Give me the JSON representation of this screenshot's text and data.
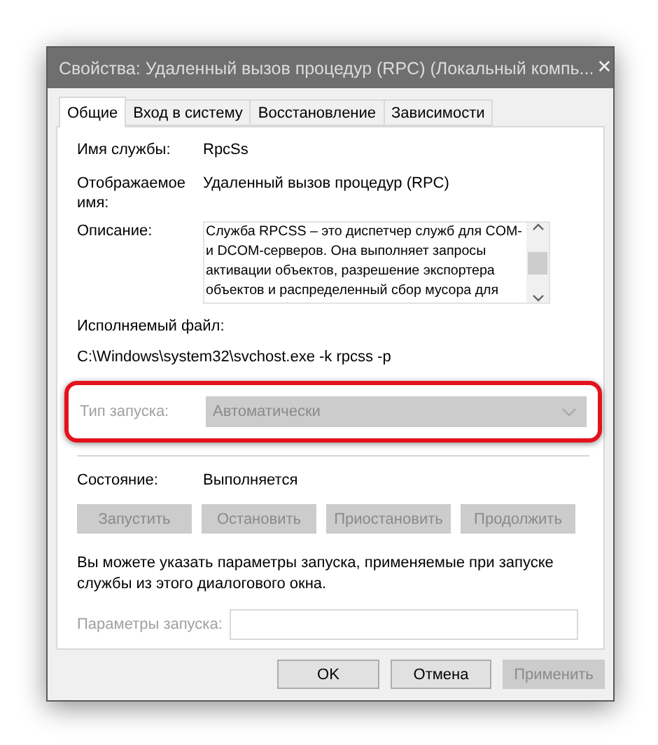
{
  "window": {
    "title": "Свойства: Удаленный вызов процедур (RPC) (Локальный компь...",
    "close": "✕"
  },
  "tabs": [
    {
      "label": "Общие",
      "selected": true
    },
    {
      "label": "Вход в систему",
      "selected": false
    },
    {
      "label": "Восстановление",
      "selected": false
    },
    {
      "label": "Зависимости",
      "selected": false
    }
  ],
  "service_name": {
    "label": "Имя службы:",
    "value": "RpcSs"
  },
  "display_name": {
    "label": "Отображаемое\nимя:",
    "value": "Удаленный вызов процедур (RPC)"
  },
  "description": {
    "label": "Описание:",
    "value": "Служба RPCSS – это диспетчер служб для COM-\nи DCOM-серверов. Она выполняет запросы\nактивации объектов, разрешение экспортера\nобъектов и распределенный сбор мусора для"
  },
  "executable": {
    "label": "Исполняемый файл:",
    "value": "C:\\Windows\\system32\\svchost.exe -k rpcss -p"
  },
  "startup_type": {
    "label": "Тип запуска:",
    "value": "Автоматически",
    "disabled": true,
    "highlighted": true
  },
  "status": {
    "label": "Состояние:",
    "value": "Выполняется"
  },
  "service_buttons": [
    {
      "label": "Запустить",
      "disabled": true
    },
    {
      "label": "Остановить",
      "disabled": true
    },
    {
      "label": "Приостановить",
      "disabled": true
    },
    {
      "label": "Продолжить",
      "disabled": true
    }
  ],
  "hint": "Вы можете указать параметры запуска, применяемые при запуске\nслужбы из этого диалогового окна.",
  "start_params": {
    "label": "Параметры запуска:",
    "disabled": true
  },
  "dialog_buttons": [
    {
      "label": "OK",
      "disabled": false
    },
    {
      "label": "Отмена",
      "disabled": false
    },
    {
      "label": "Применить",
      "disabled": true
    }
  ]
}
